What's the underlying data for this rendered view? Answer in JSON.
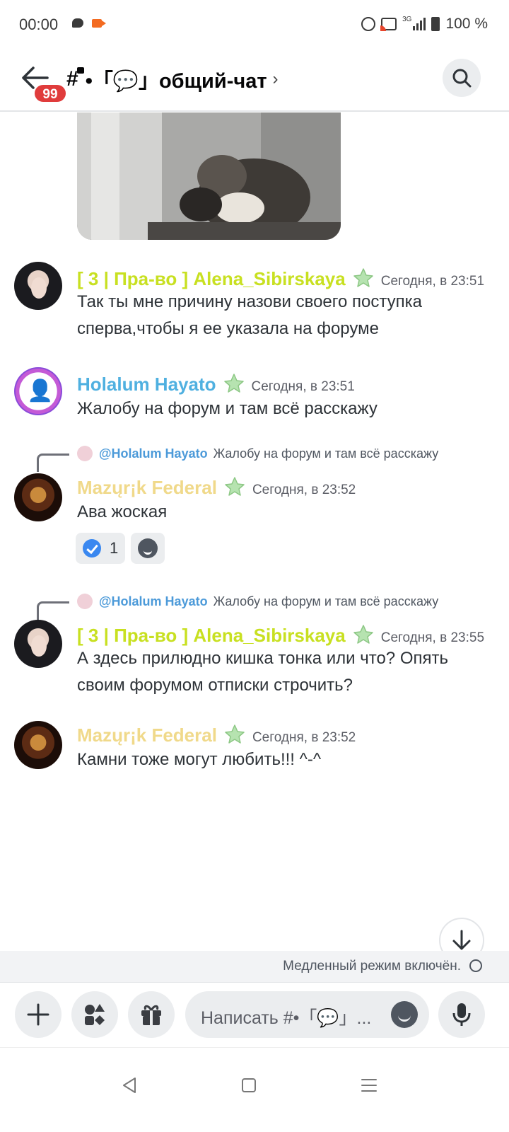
{
  "status_bar": {
    "time": "00:00",
    "network": "3G",
    "battery": "100 %"
  },
  "header": {
    "unread_count": "99",
    "channel_name": "•「💬」общий-чат"
  },
  "messages": [
    {
      "author": "[ 3 | Пра-во ] Alena_Sibirskaya",
      "timestamp": "Сегодня, в 23:51",
      "text": "Так ты мне причину назови своего поступка сперва,чтобы я ее указала на форуме"
    },
    {
      "author": "Holalum Hayato",
      "timestamp": "Сегодня, в 23:51",
      "text": "Жалобу на форум и там всё расскажу"
    },
    {
      "reply_mention": "@Holalum Hayato",
      "reply_text": "Жалобу на форум и там всё расскажу",
      "author": "Mazųr¡k Federal",
      "timestamp": "Сегодня, в 23:52",
      "text": "Ава жоская",
      "reaction_count": "1"
    },
    {
      "reply_mention": "@Holalum Hayato",
      "reply_text": "Жалобу на форум и там всё расскажу",
      "author": "[ 3 | Пра-во ] Alena_Sibirskaya",
      "timestamp": "Сегодня, в 23:55",
      "text": "А здесь прилюдно кишка тонка или что? Опять своим форумом отписки строчить?"
    },
    {
      "author": "Mazųr¡k Federal",
      "timestamp": "Сегодня, в 23:52",
      "text": "Камни тоже могут любить!!! ^-^"
    }
  ],
  "slow_mode": {
    "text": "Медленный режим включён."
  },
  "composer": {
    "placeholder": "Написать #•「💬」..."
  },
  "colors": {
    "alena": "#c8e021",
    "holalum": "#4fb0e0",
    "mazu": "#f0d98a",
    "badge": "#e03c3c"
  }
}
